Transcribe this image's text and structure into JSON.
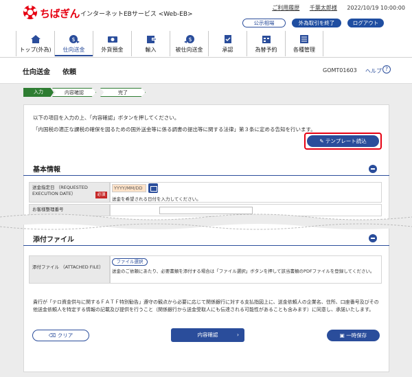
{
  "brand": {
    "logo_text": "ちばぎん",
    "service_name": "インターネットEBサービス <Web-EB>",
    "accent": "#e60012",
    "primary": "#2a4d9b"
  },
  "top_links": {
    "history": "ご利用履歴",
    "user": "千葉太郎様",
    "datetime": "2022/10/19 10:00:00"
  },
  "header_buttons": {
    "public_quote": "公示相場",
    "end_fx": "外為取引を終了",
    "logout": "ログアウト"
  },
  "nav": [
    {
      "label": "トップ(外為)",
      "icon": "home-icon"
    },
    {
      "label": "仕向送金",
      "icon": "remittance-icon"
    },
    {
      "label": "外貨預金",
      "icon": "deposit-icon"
    },
    {
      "label": "輸入",
      "icon": "import-icon"
    },
    {
      "label": "被仕向送金",
      "icon": "incoming-icon"
    },
    {
      "label": "承認",
      "icon": "approve-icon"
    },
    {
      "label": "為替予約",
      "icon": "forward-icon"
    },
    {
      "label": "各種管理",
      "icon": "manage-icon"
    }
  ],
  "page": {
    "title": "仕向送金",
    "subtitle": "依頼",
    "screen_id": "GOMT01603",
    "help": "ヘルプ",
    "help_glyph": "?"
  },
  "steps": [
    "入力",
    "内容確認",
    "完了"
  ],
  "intro": {
    "line1": "以下の項目を入力の上、「内容確認」ボタンを押してください。",
    "line2": "「内国税の適正な課税の確保を図るための国外送金等に係る調書の提出等に関する法律」第３条に定める告知を行います。"
  },
  "template_button": "テンプレート読込",
  "section_basic": "基本情報",
  "fields": {
    "date_label": "送金指定日 （REQUESTED EXECUTION DATE）",
    "required": "必須",
    "date_placeholder": "YYYY/MM/DD",
    "date_hint": "送金を希望される日付を入力してください。",
    "ref_label": "お客様整理番号"
  },
  "section_attach": "添付ファイル",
  "attach": {
    "label": "添付ファイル （ATTACHED FILE）",
    "file_button": "ファイル選択",
    "hint": "送金のご依頼にあたり、必要書類を添付する場合は「ファイル選択」ボタンを押して該当書類のPDFファイルを登録してください。"
  },
  "notice": "貴行が「テロ資金供与に関するＦＡＴＦ特別勧告」遵守の観点から必要に応じて関係銀行に対する支払指図上に、送金依頼人の企業名、住所、口座番号及びその他送金依頼人を特定する情報の記載及び提供を行うこと（関係銀行から送金受取人にも伝達される可能性があることも含みます）に同意し、承諾いたします。",
  "buttons": {
    "clear": "クリア",
    "confirm": "内容確認",
    "save": "一時保存"
  }
}
